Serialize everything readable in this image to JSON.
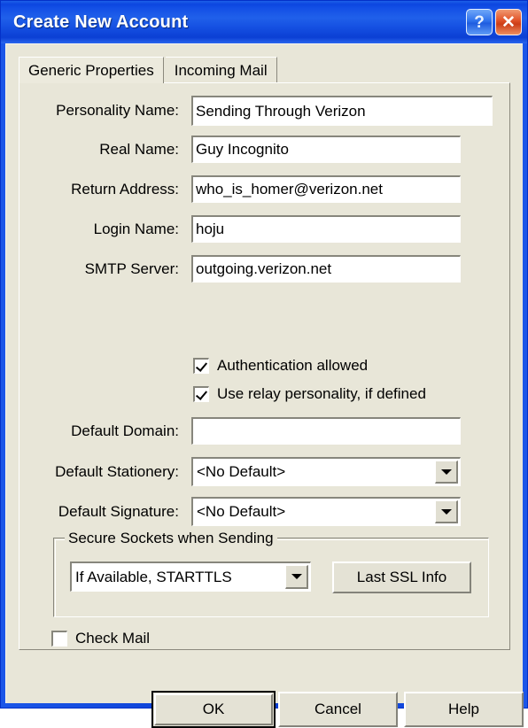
{
  "window": {
    "title": "Create New Account",
    "help_button": "?",
    "close_button": "✕"
  },
  "tabs": [
    {
      "label": "Generic Properties",
      "active": true
    },
    {
      "label": "Incoming Mail",
      "active": false
    }
  ],
  "fields": {
    "personality_name": {
      "label": "Personality Name:",
      "value": "Sending Through Verizon",
      "placeholder": ""
    },
    "real_name": {
      "label": "Real Name:",
      "value": "Guy Incognito",
      "placeholder": ""
    },
    "return_address": {
      "label": "Return Address:",
      "value": "who_is_homer@verizon.net",
      "placeholder": ""
    },
    "login_name": {
      "label": "Login Name:",
      "value": "hoju",
      "placeholder": ""
    },
    "smtp_server": {
      "label": "SMTP Server:",
      "value": "outgoing.verizon.net",
      "placeholder": ""
    },
    "default_domain": {
      "label": "Default Domain:",
      "value": "",
      "placeholder": ""
    }
  },
  "checkboxes": {
    "authentication_allowed": {
      "label": "Authentication allowed",
      "checked": true
    },
    "use_relay_personality": {
      "label": "Use relay personality, if defined",
      "checked": true
    },
    "check_mail": {
      "label": "Check Mail",
      "checked": false
    }
  },
  "dropdowns": {
    "default_stationery": {
      "label": "Default Stationery:",
      "value": "<No Default>"
    },
    "default_signature": {
      "label": "Default Signature:",
      "value": "<No Default>"
    },
    "secure_sockets": {
      "value": "If Available, STARTTLS"
    }
  },
  "groupbox": {
    "secure_sockets_title": "Secure Sockets when Sending",
    "last_ssl_info_button": "Last SSL Info"
  },
  "footer": {
    "ok": "OK",
    "cancel": "Cancel",
    "help": "Help"
  },
  "colors": {
    "title_blue": "#0b3fd4",
    "dialog_face": "#e8e6d8",
    "close_red": "#cc3d17",
    "field_white": "#ffffff"
  }
}
